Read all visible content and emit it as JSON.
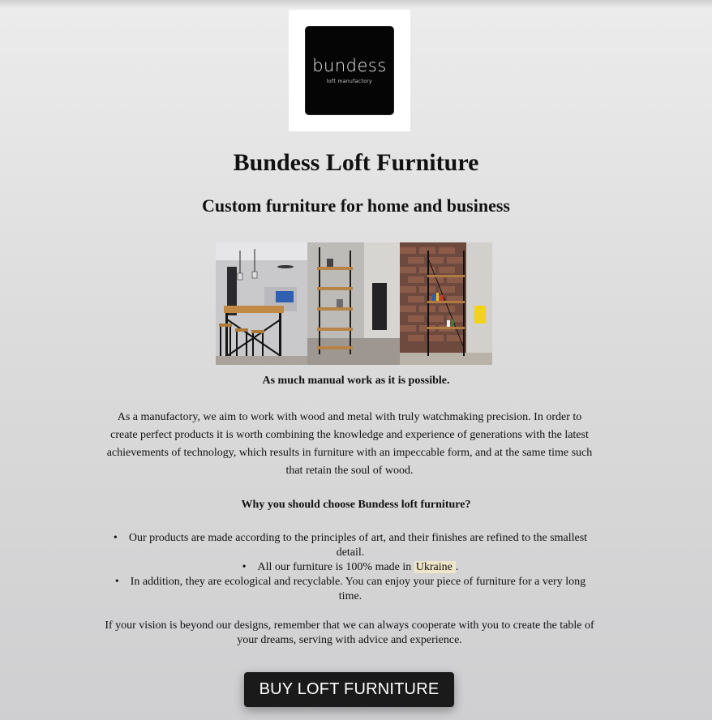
{
  "logo": {
    "word": "bundess",
    "tagline": "loft manufactory"
  },
  "title": "Bundess Loft Furniture",
  "subtitle": "Custom furniture for home and business",
  "intro_bold": "As much manual work as it is possible.",
  "intro_body": "As a manufactory, we aim to work with wood and metal with truly watchmaking precision. In order to create perfect products it is worth combining the knowledge and experience of generations with the latest achievements of technology, which results in furniture with an impeccable form, and at the same time such that retain the soul of wood.",
  "why_heading": "Why you should choose Bundess loft furniture?",
  "benefits": [
    "Our products are made according to the principles of art, and their finishes are refined to the smallest detail.",
    "All our furniture is 100% made in",
    "In addition, they are ecological and recyclable. You can enjoy your piece of furniture for a very long time."
  ],
  "highlight_country": "Ukraine",
  "benefit_2_suffix": ".",
  "closing": "If your vision is beyond our designs, remember that we can always cooperate with you to create the table of your dreams, serving with advice and experience.",
  "cta": "BUY LOFT FURNITURE",
  "colors": {
    "button_bg": "#1a1a1a",
    "highlight_bg": "#efe5c8"
  }
}
